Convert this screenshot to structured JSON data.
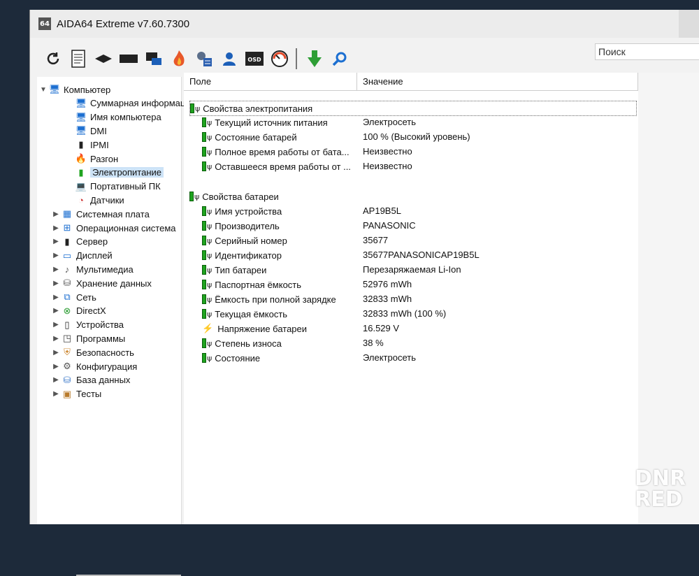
{
  "window": {
    "title": "AIDA64 Extreme v7.60.7300",
    "badge": "64"
  },
  "toolbar": {
    "icons": [
      "refresh-icon",
      "report-icon",
      "motherboard-icon",
      "memory-icon",
      "network-icon",
      "flame-icon",
      "config-icon",
      "user-icon",
      "osd-icon",
      "gauge-icon",
      "download-icon",
      "search-icon"
    ],
    "osd_label": "OSD",
    "search_placeholder": "Поиск"
  },
  "tree": {
    "items": [
      {
        "label": "Компьютер",
        "level": 0,
        "expanded": true,
        "icon": "computer-icon"
      },
      {
        "label": "Суммарная информаци",
        "level": 1,
        "icon": "monitor-icon"
      },
      {
        "label": "Имя компьютера",
        "level": 1,
        "icon": "monitor-icon"
      },
      {
        "label": "DMI",
        "level": 1,
        "icon": "monitor-icon"
      },
      {
        "label": "IPMI",
        "level": 1,
        "icon": "server-icon"
      },
      {
        "label": "Разгон",
        "level": 1,
        "icon": "flame-icon"
      },
      {
        "label": "Электропитание",
        "level": 1,
        "icon": "battery-icon",
        "selected": true
      },
      {
        "label": "Портативный ПК",
        "level": 1,
        "icon": "laptop-icon"
      },
      {
        "label": "Датчики",
        "level": 1,
        "icon": "gauge-icon"
      },
      {
        "label": "Системная плата",
        "level": 0,
        "icon": "motherboard-icon"
      },
      {
        "label": "Операционная система",
        "level": 0,
        "icon": "windows-icon"
      },
      {
        "label": "Сервер",
        "level": 0,
        "icon": "server-icon"
      },
      {
        "label": "Дисплей",
        "level": 0,
        "icon": "display-icon"
      },
      {
        "label": "Мультимедиа",
        "level": 0,
        "icon": "speaker-icon"
      },
      {
        "label": "Хранение данных",
        "level": 0,
        "icon": "storage-icon"
      },
      {
        "label": "Сеть",
        "level": 0,
        "icon": "network-icon"
      },
      {
        "label": "DirectX",
        "level": 0,
        "icon": "xbox-icon"
      },
      {
        "label": "Устройства",
        "level": 0,
        "icon": "devices-icon"
      },
      {
        "label": "Программы",
        "level": 0,
        "icon": "programs-icon"
      },
      {
        "label": "Безопасность",
        "level": 0,
        "icon": "shield-icon"
      },
      {
        "label": "Конфигурация",
        "level": 0,
        "icon": "config-icon"
      },
      {
        "label": "База данных",
        "level": 0,
        "icon": "database-icon"
      },
      {
        "label": "Тесты",
        "level": 0,
        "icon": "tests-icon"
      }
    ]
  },
  "list": {
    "col_field": "Поле",
    "col_value": "Значение",
    "groups": [
      {
        "title": "Свойства электропитания",
        "rows": [
          {
            "field": "Текущий источник питания",
            "value": "Электросеть"
          },
          {
            "field": "Состояние батарей",
            "value": "100 % (Высокий уровень)"
          },
          {
            "field": "Полное время работы от бата...",
            "value": "Неизвестно"
          },
          {
            "field": "Оставшееся время работы от ...",
            "value": "Неизвестно"
          }
        ]
      },
      {
        "title": "Свойства батареи",
        "rows": [
          {
            "field": "Имя устройства",
            "value": "AP19B5L"
          },
          {
            "field": "Производитель",
            "value": "PANASONIC"
          },
          {
            "field": "Серийный номер",
            "value": "35677"
          },
          {
            "field": "Идентификатор",
            "value": "35677PANASONICAP19B5L"
          },
          {
            "field": "Тип батареи",
            "value": "Перезаряжаемая Li-Ion"
          },
          {
            "field": "Паспортная ёмкость",
            "value": "52976 mWh"
          },
          {
            "field": "Ёмкость при полной зарядке",
            "value": "32833 mWh"
          },
          {
            "field": "Текущая ёмкость",
            "value": "32833 mWh  (100 %)"
          },
          {
            "field": "Напряжение батареи",
            "value": "16.529 V",
            "icon": "voltage-icon"
          },
          {
            "field": "Степень износа",
            "value": "38 %"
          },
          {
            "field": "Состояние",
            "value": "Электросеть"
          }
        ]
      }
    ]
  },
  "watermark": {
    "line1": "DNR",
    "line2": "RED"
  }
}
